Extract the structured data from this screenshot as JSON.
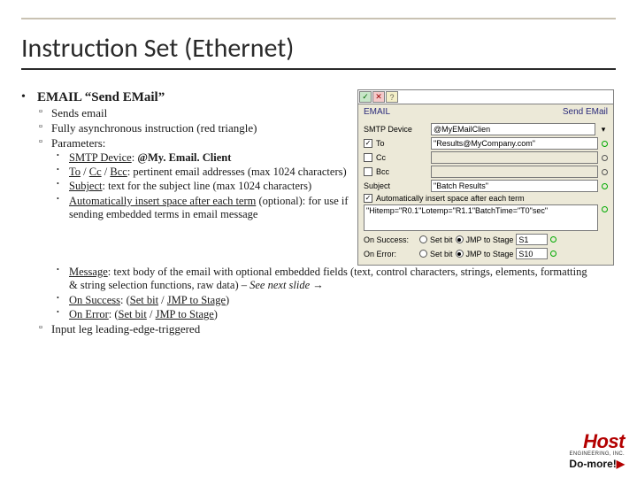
{
  "title": "Instruction Set (Ethernet)",
  "main_bullet": "EMAIL “Send EMail”",
  "sub": {
    "sends": "Sends email",
    "async": "Fully asynchronous instruction (red triangle)",
    "params": "Parameters:",
    "input_leg": "Input leg leading-edge-triggered"
  },
  "params": {
    "smtp_label": "SMTP Device",
    "smtp_rest": ": ",
    "smtp_val": "@My. Email. Client",
    "tocc_to": "To",
    "tocc_sep1": " / ",
    "tocc_cc": "Cc",
    "tocc_sep2": " / ",
    "tocc_bcc": "Bcc",
    "tocc_rest": ": pertinent email addresses (max 1024 characters)",
    "subject_label": "Subject",
    "subject_rest": ": text for the subject line (max 1024 characters)",
    "autospace_u": "Automatically insert space after each term",
    "autospace_rest": " (optional): for use if sending embedded terms in email message",
    "message_label": "Message",
    "message_rest": ": text body of the email with optional embedded fields (text, control characters, strings, elements, formatting & string selection functions, raw data) – ",
    "message_it": "See next slide",
    "message_arrow": " →",
    "onsucc_label": "On Success",
    "onsucc_rest": ": (",
    "onsucc_a": "Set bit",
    "onsucc_mid": " / ",
    "onsucc_b": "JMP to Stage",
    "onsucc_end": ")",
    "onerr_label": "On Error",
    "onerr_rest": ": (",
    "onerr_a": "Set bit",
    "onerr_mid": " / ",
    "onerr_b": "JMP to Stage",
    "onerr_end": ")"
  },
  "dlg": {
    "ok": "✓",
    "x": "✕",
    "q": "?",
    "hdr_l": "EMAIL",
    "hdr_r": "Send EMail",
    "smtp_lbl": "SMTP Device",
    "smtp_val": "@MyEMailClien",
    "to_lbl": "To",
    "to_val": "\"Results@MyCompany.com\"",
    "cc_lbl": "Cc",
    "bcc_lbl": "Bcc",
    "subj_lbl": "Subject",
    "subj_val": "\"Batch Results\"",
    "auto_lbl": "Automatically insert space after each term",
    "msg_val": "\"Hitemp=\"R0.1\"Lotemp=\"R1.1\"BatchTime=\"T0\"sec\"",
    "succ_lbl": "On Success:",
    "setbit_lbl": "Set bit",
    "jmp_lbl": "JMP to Stage",
    "succ_stage": "S1",
    "err_lbl": "On Error:",
    "err_stage": "S10"
  },
  "logo": {
    "host": "Host",
    "eng": "ENGINEERING, INC.",
    "domore": "Do-more!"
  }
}
